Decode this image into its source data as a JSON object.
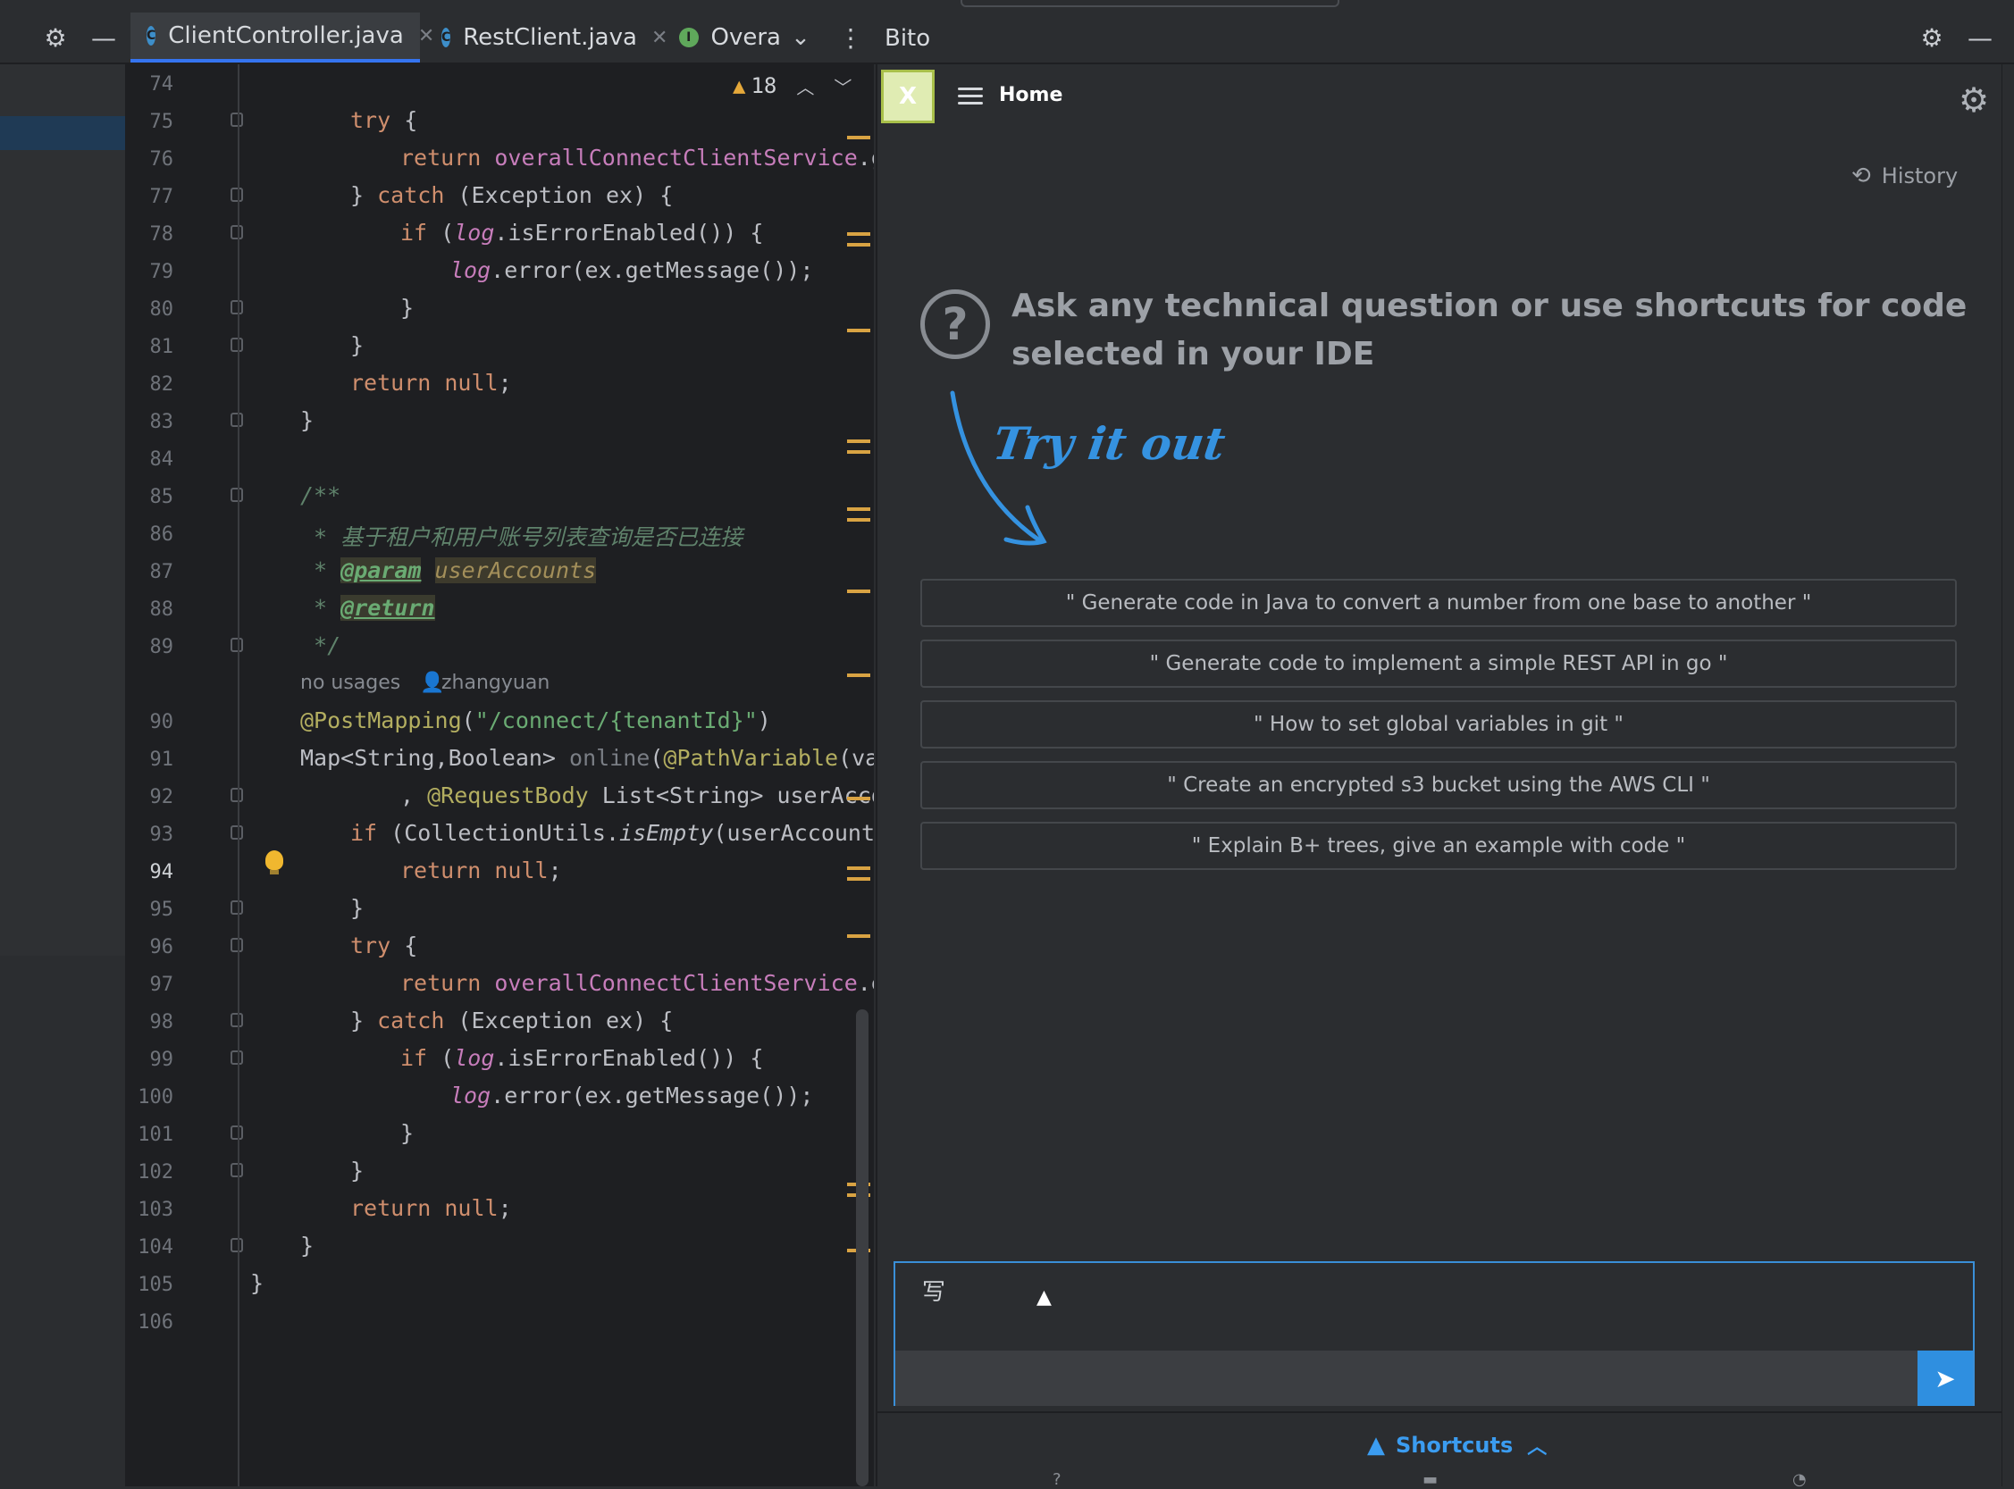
{
  "toolbar": {
    "tabs": [
      {
        "label": "ClientController.java",
        "icon": "C",
        "icon_color": "#3d8ec9"
      },
      {
        "label": "RestClient.java",
        "icon": "C",
        "icon_color": "#3d8ec9"
      },
      {
        "label": "Overa",
        "icon": "I",
        "icon_color": "#5fa85b"
      }
    ],
    "panel_title": "Bito"
  },
  "editor": {
    "warnings_count": "18",
    "lines": [
      {
        "n": "74"
      },
      {
        "n": "75"
      },
      {
        "n": "76"
      },
      {
        "n": "77"
      },
      {
        "n": "78"
      },
      {
        "n": "79"
      },
      {
        "n": "80"
      },
      {
        "n": "81"
      },
      {
        "n": "82"
      },
      {
        "n": "83"
      },
      {
        "n": "84"
      },
      {
        "n": "85"
      },
      {
        "n": "86"
      },
      {
        "n": "87"
      },
      {
        "n": "88"
      },
      {
        "n": "89"
      },
      {
        "n": "90"
      },
      {
        "n": "91"
      },
      {
        "n": "92"
      },
      {
        "n": "93"
      },
      {
        "n": "94"
      },
      {
        "n": "95"
      },
      {
        "n": "96"
      },
      {
        "n": "97"
      },
      {
        "n": "98"
      },
      {
        "n": "99"
      },
      {
        "n": "100"
      },
      {
        "n": "101"
      },
      {
        "n": "102"
      },
      {
        "n": "103"
      },
      {
        "n": "104"
      },
      {
        "n": "105"
      },
      {
        "n": "106"
      }
    ],
    "inlay_usages": "no usages",
    "inlay_author": "zhangyuan"
  },
  "bito": {
    "home_label": "Home",
    "logo_letter": "X",
    "history_label": "History",
    "prompt_heading": "Ask any technical question or use shortcuts for code selected in your IDE",
    "try_label": "Try it out",
    "suggestions": [
      "\" Generate code in Java to convert a number from one base to another \"",
      "\" Generate code to implement a simple REST API in go \"",
      "\" How to set global variables in git \"",
      "\" Create an encrypted s3 bucket using the AWS CLI \"",
      "\" Explain B+ trees, give an example with code \""
    ],
    "input_value": "写",
    "shortcuts_label": "Shortcuts"
  }
}
